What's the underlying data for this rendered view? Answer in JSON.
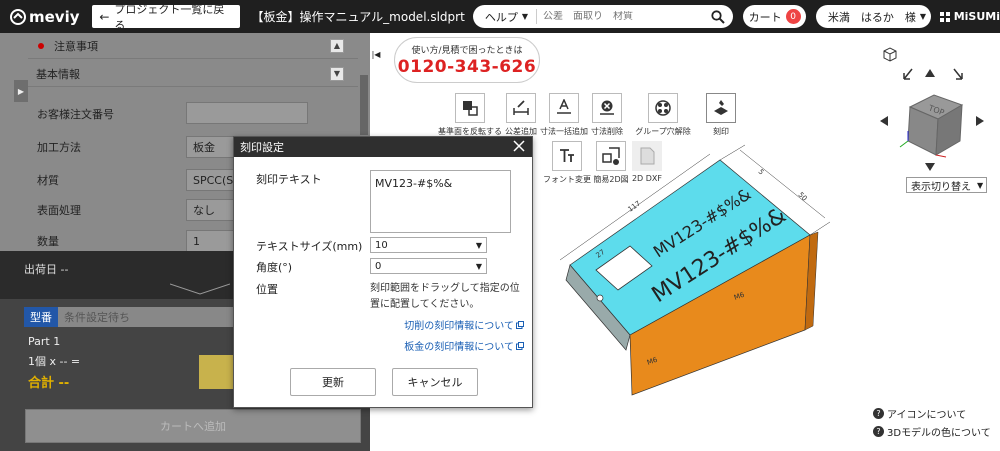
{
  "header": {
    "logo": "meviy",
    "back_label": "プロジェクト一覧に戻る",
    "file_title": "【板金】操作マニュアル_model.sldprt",
    "help_label": "ヘルプ",
    "search_placeholder": "公差　面取り　材質",
    "cart_label": "カート",
    "cart_count": "0",
    "user_label": "米満　はるか　様",
    "brand": "MiSUMi"
  },
  "sidebar": {
    "notice": "注意事項",
    "basic_info": "基本情報",
    "fields": [
      {
        "label": "お客様注文番号",
        "value": ""
      },
      {
        "label": "加工方法",
        "value": "板金"
      },
      {
        "label": "材質",
        "value": "SPCC(SP"
      },
      {
        "label": "表面処理",
        "value": "なし"
      },
      {
        "label": "数量",
        "value": "1"
      }
    ],
    "ship_label": "出荷日 --",
    "model_tag": "型番",
    "model_value": "条件設定待ち",
    "part_name": "Part 1",
    "qty_line": "1個  x -- =",
    "total": "合計 --",
    "cart_add": "カートへ追加"
  },
  "viewer": {
    "contact_line1": "使い方/見積で困ったときは",
    "contact_phone": "0120-343-626",
    "tools_row1": [
      "基準面を反転する",
      "公差追加",
      "寸法一括追加",
      "寸法削除",
      "グループ穴解除",
      "刻印"
    ],
    "tools_row2": [
      "フォント変更",
      "簡易2D図",
      "2D DXF"
    ],
    "view_switch": "表示切り替え",
    "help_icons": "アイコンについて",
    "help_colors": "3Dモデルの色について",
    "cube_top": "TOP"
  },
  "modal": {
    "title": "刻印設定",
    "text_label": "刻印テキスト",
    "text_value": "MV123-#$%&",
    "size_label": "テキストサイズ(mm)",
    "size_value": "10",
    "angle_label": "角度(°)",
    "angle_value": "0",
    "pos_label": "位置",
    "pos_note": "刻印範囲をドラッグして指定の位置に配置してください。",
    "link1": "切削の刻印情報について",
    "link2": "板金の刻印情報について",
    "update": "更新",
    "cancel": "キャンセル"
  },
  "model_labels": {
    "engrave_big": "MV123-#$%&",
    "engrave_small": "MV123-#$%&",
    "tag1": "M6",
    "tag2": "M6",
    "dim1": "117",
    "dim2": "27",
    "dim3": "50",
    "dim4": "5"
  },
  "colors": {
    "accent": "#2257a8",
    "danger": "#dd2222",
    "model_orange": "#e88a1c",
    "model_cyan": "#5ddcec"
  }
}
